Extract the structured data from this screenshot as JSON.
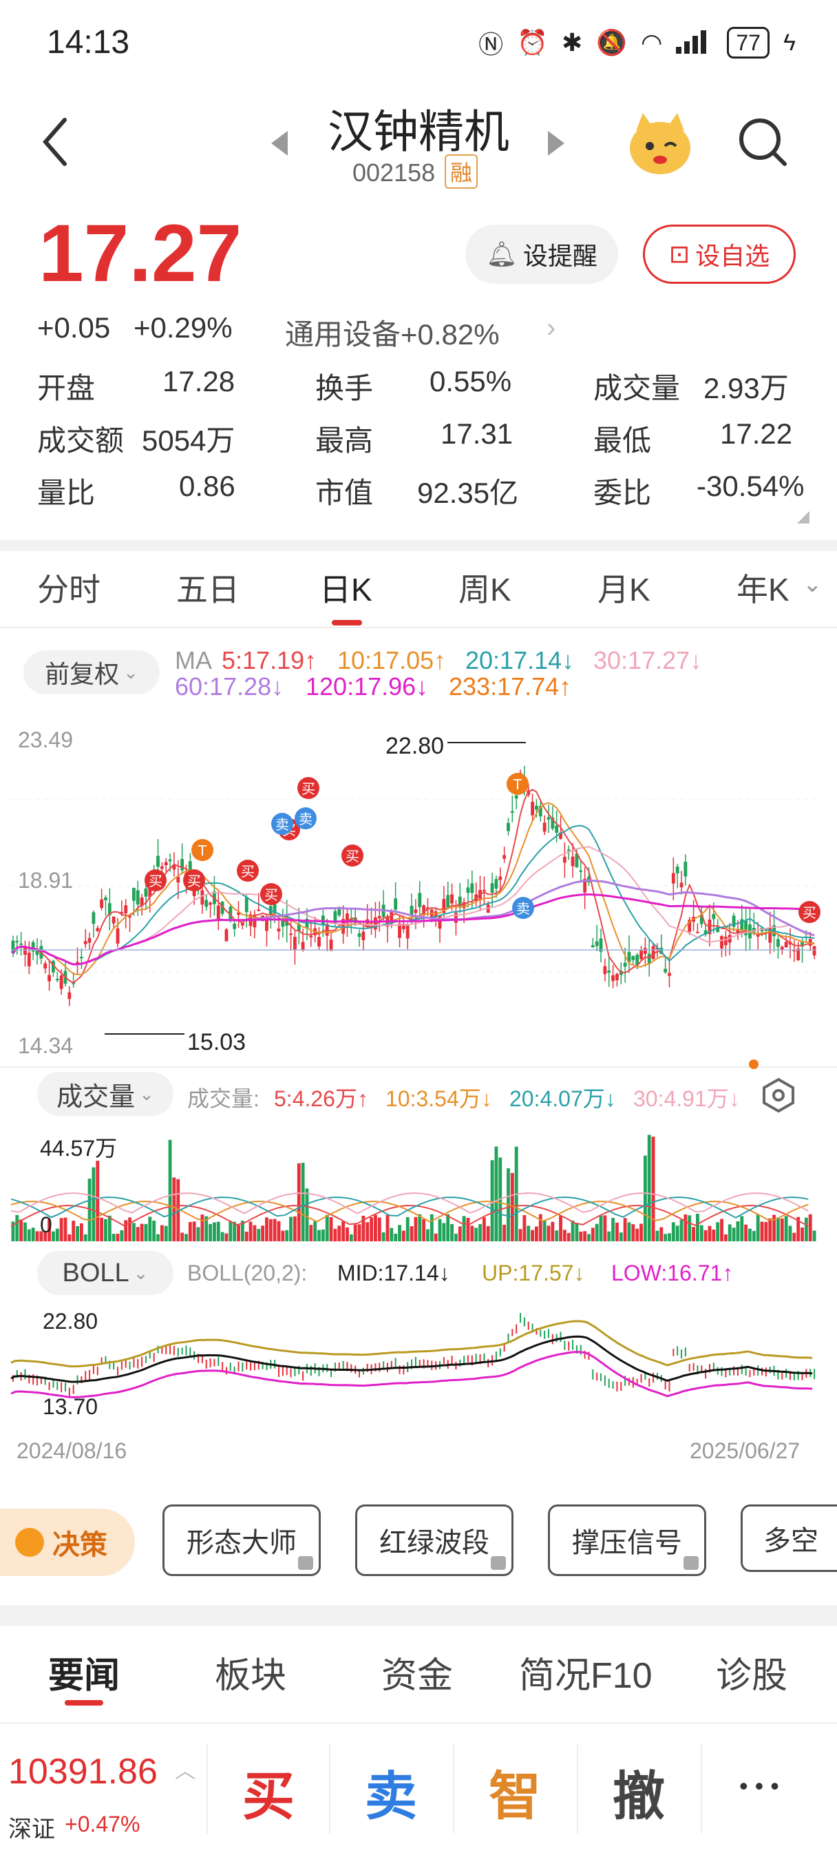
{
  "status": {
    "time": "14:13",
    "battery": "77"
  },
  "header": {
    "name": "汉钟精机",
    "code": "002158",
    "badge": "融"
  },
  "quote": {
    "price": "17.27",
    "change": "+0.05",
    "change_pct": "+0.29%",
    "sector": "通用设备+0.82%",
    "alert_label": "设提醒",
    "watch_label": "设自选",
    "fields": [
      {
        "label": "开盘",
        "value": "17.28"
      },
      {
        "label": "换手",
        "value": "0.55%"
      },
      {
        "label": "成交量",
        "value": "2.93万"
      },
      {
        "label": "成交额",
        "value": "5054万"
      },
      {
        "label": "最高",
        "value": "17.31"
      },
      {
        "label": "最低",
        "value": "17.22"
      },
      {
        "label": "量比",
        "value": "0.86"
      },
      {
        "label": "市值",
        "value": "92.35亿"
      },
      {
        "label": "委比",
        "value": "-30.54%"
      }
    ]
  },
  "tabs": [
    "分时",
    "五日",
    "日K",
    "周K",
    "月K",
    "年K"
  ],
  "chart": {
    "adjust_label": "前复权",
    "ma_prefix": "MA",
    "ma": [
      "5:17.19↑",
      "10:17.05↑",
      "20:17.14↓",
      "30:17.27↓",
      "60:17.28↓",
      "120:17.96↓",
      "233:17.74↑"
    ],
    "ma_colors": [
      "#e8484a",
      "#e6902a",
      "#2aa0a8",
      "#f0a6b8",
      "#b07be0",
      "#e020c8",
      "#f07a18"
    ],
    "y_top": "23.49",
    "y_mid": "18.91",
    "y_bot": "14.34",
    "high_label": "22.80",
    "low_label": "15.03",
    "vol_selector": "成交量",
    "vol_text": "成交量:",
    "vol_ma": [
      "5:4.26万↑",
      "10:3.54万↓",
      "20:4.07万↓",
      "30:4.91万↓"
    ],
    "vol_max": "44.57万",
    "vol_zero": "0",
    "boll_selector": "BOLL",
    "boll_text": "BOLL(20,2):",
    "boll_mid": "MID:17.14↓",
    "boll_up": "UP:17.57↓",
    "boll_low": "LOW:16.71↑",
    "boll_top": "22.80",
    "boll_bot": "13.70",
    "date_start": "2024/08/16",
    "date_end": "2025/06/27",
    "markers": [
      "买",
      "卖",
      "T"
    ]
  },
  "tools": {
    "decision": "决策",
    "items": [
      "形态大师",
      "红绿波段",
      "撑压信号",
      "多空"
    ]
  },
  "bottom_tabs": [
    "要闻",
    "板块",
    "资金",
    "简况F10",
    "诊股"
  ],
  "footer": {
    "index_value": "10391.86",
    "index_name": "深证",
    "index_change": "+0.47%",
    "actions": [
      "买",
      "卖",
      "智",
      "撤"
    ],
    "more": "• • •"
  }
}
